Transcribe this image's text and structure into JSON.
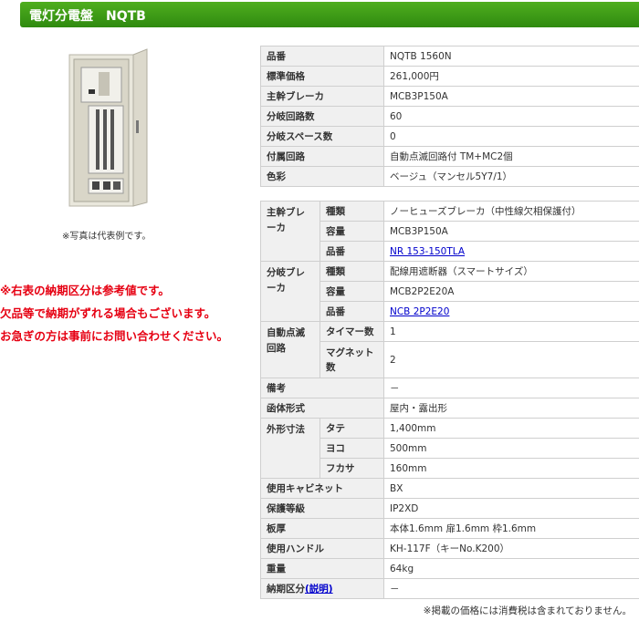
{
  "header": {
    "title": "電灯分電盤　NQTB"
  },
  "photo": {
    "caption": "※写真は代表例です。"
  },
  "notes": [
    "※右表の納期区分は参考値です。",
    "欠品等で納期がずれる場合もございます。",
    "お急ぎの方は事前にお問い合わせください。"
  ],
  "table1": [
    {
      "label": "品番",
      "value": "NQTB 1560N"
    },
    {
      "label": "標準価格",
      "value": "261,000円"
    },
    {
      "label": "主幹ブレーカ",
      "value": "MCB3P150A"
    },
    {
      "label": "分岐回路数",
      "value": "60"
    },
    {
      "label": "分岐スペース数",
      "value": "0"
    },
    {
      "label": "付属回路",
      "value": "自動点滅回路付 TM+MC2個"
    },
    {
      "label": "色彩",
      "value": "ベージュ（マンセル5Y7/1）"
    }
  ],
  "table2": {
    "main_breaker": {
      "label": "主幹ブレーカ",
      "rows": [
        {
          "label": "種類",
          "value": "ノーヒューズブレーカ（中性線欠相保護付）"
        },
        {
          "label": "容量",
          "value": "MCB3P150A"
        },
        {
          "label": "品番",
          "value": "NR 153-150TLA"
        }
      ]
    },
    "branch_breaker": {
      "label": "分岐ブレーカ",
      "rows": [
        {
          "label": "種類",
          "value": "配線用遮断器（スマートサイズ）"
        },
        {
          "label": "容量",
          "value": "MCB2P2E20A"
        },
        {
          "label": "品番",
          "value": "NCB 2P2E20"
        }
      ]
    },
    "auto_circuit": {
      "label": "自動点滅回路",
      "rows": [
        {
          "label": "タイマー数",
          "value": "1"
        },
        {
          "label": "マグネット数",
          "value": "2"
        }
      ]
    },
    "remarks": {
      "label": "備考",
      "value": "－"
    },
    "enclosure": {
      "label": "函体形式",
      "value": "屋内・露出形"
    },
    "dimensions": {
      "label": "外形寸法",
      "rows": [
        {
          "label": "タテ",
          "value": "1,400mm"
        },
        {
          "label": "ヨコ",
          "value": "500mm"
        },
        {
          "label": "フカサ",
          "value": "160mm"
        }
      ]
    },
    "cabinet": {
      "label": "使用キャビネット",
      "value": "BX"
    },
    "protection": {
      "label": "保護等級",
      "value": "IP2XD"
    },
    "thickness": {
      "label": "板厚",
      "value": "本体1.6mm 扉1.6mm 枠1.6mm"
    },
    "handle": {
      "label": "使用ハンドル",
      "value": "KH-117F（キーNo.K200）"
    },
    "weight": {
      "label": "重量",
      "value": "64kg"
    },
    "delivery": {
      "label": "納期区分",
      "link": "(説明)",
      "value": "－"
    }
  },
  "footnote": "※掲載の価格には消費税は含まれておりません。"
}
